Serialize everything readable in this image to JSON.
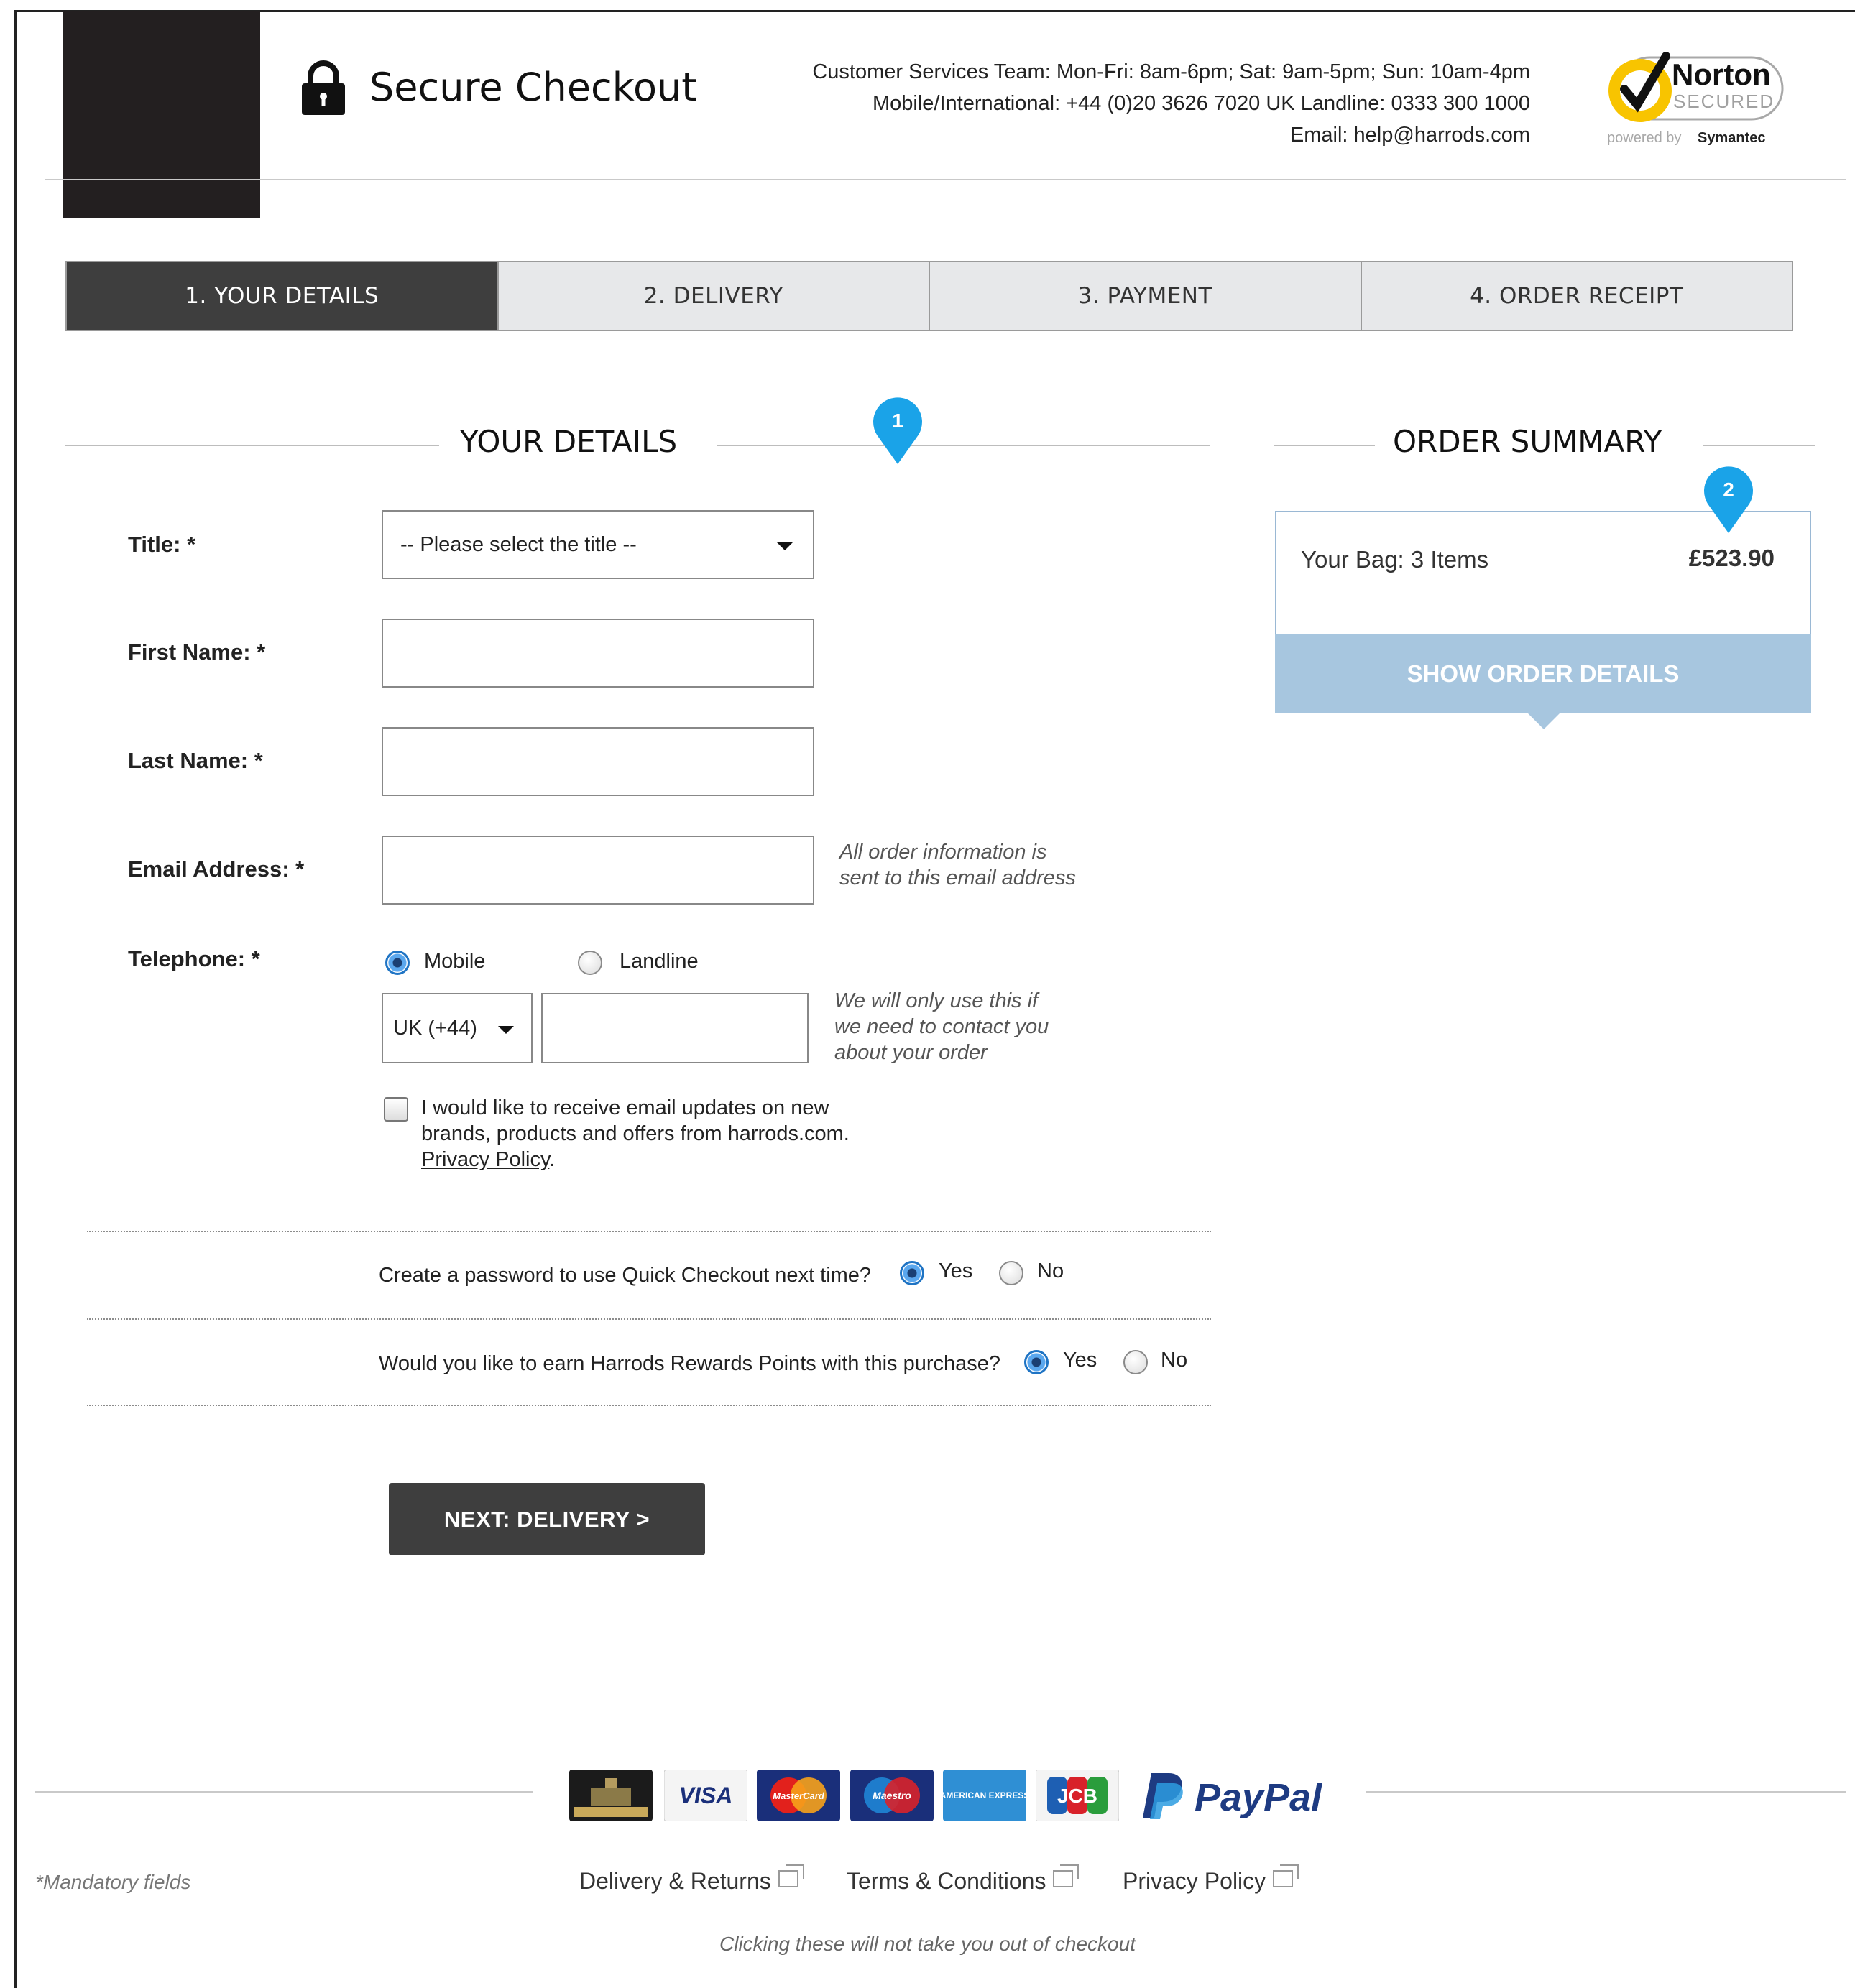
{
  "header": {
    "title": "Secure Checkout",
    "contact_lines": [
      "Customer Services Team: Mon-Fri: 8am-6pm; Sat: 9am-5pm; Sun: 10am-4pm",
      "Mobile/International: +44 (0)20 3626 7020 UK Landline: 0333 300 1000",
      "Email: help@harrods.com"
    ],
    "norton": {
      "brand": "Norton",
      "secured": "SECURED",
      "powered": "powered by",
      "symantec": "Symantec"
    }
  },
  "steps": [
    "1. YOUR DETAILS",
    "2. DELIVERY",
    "3. PAYMENT",
    "4. ORDER RECEIPT"
  ],
  "details": {
    "heading": "YOUR DETAILS",
    "pin_label": "1",
    "title_label": "Title: *",
    "title_placeholder": "-- Please select the title --",
    "first_name_label": "First Name: *",
    "last_name_label": "Last Name: *",
    "email_label": "Email Address: *",
    "email_hint": [
      "All order information is",
      "sent to this email address"
    ],
    "telephone_label": "Telephone: *",
    "phone_type_options": [
      "Mobile",
      "Landline"
    ],
    "phone_type_selected": "Mobile",
    "country_code": "UK (+44)",
    "phone_hint": [
      "We will only use this if",
      "we need to contact you",
      "about your order"
    ],
    "consent_text_1": "I would like to receive email updates on new brands, products and offers from harrods.com.",
    "consent_link": "Privacy Policy",
    "consent_end": ".",
    "question_password": "Create a password to use Quick Checkout next time?",
    "question_rewards": "Would you like to earn Harrods Rewards Points with this purchase?",
    "yes": "Yes",
    "no": "No",
    "next_button": "NEXT: DELIVERY  >"
  },
  "summary": {
    "heading": "ORDER SUMMARY",
    "pin_label": "2",
    "bag_label": "Your Bag: 3 Items",
    "bag_total": "£523.90",
    "show_details": "SHOW ORDER DETAILS"
  },
  "footer": {
    "payment_cards": [
      "VISA",
      "MasterCard",
      "Maestro",
      "AMERICAN EXPRESS",
      "JCB"
    ],
    "paypal": "PayPal",
    "mandatory": "*Mandatory fields",
    "links": [
      "Delivery & Returns",
      "Terms & Conditions",
      "Privacy Policy"
    ],
    "note": "Clicking these will not take you out of checkout"
  },
  "colors": {
    "dark": "#3e3e3e",
    "accent_blue": "#1aa3e8",
    "summary_blue": "#a7c6df"
  }
}
